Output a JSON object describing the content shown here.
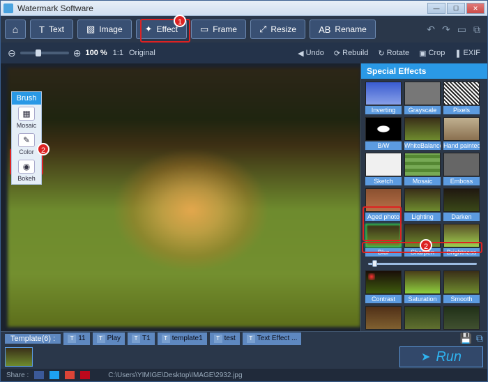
{
  "window": {
    "title": "Watermark Software"
  },
  "toolbar": {
    "tabs": [
      {
        "label": "Text",
        "icon": "T"
      },
      {
        "label": "Image",
        "icon": "▧"
      },
      {
        "label": "Effect",
        "icon": "✦"
      },
      {
        "label": "Frame",
        "icon": "▭"
      },
      {
        "label": "Resize",
        "icon": "⤢"
      },
      {
        "label": "Rename",
        "icon": "AB"
      }
    ]
  },
  "subbar": {
    "zoom_pct": "100 %",
    "ratio": "1:1",
    "size_label": "Original",
    "actions": {
      "undo": "Undo",
      "rebuild": "Rebuild",
      "rotate": "Rotate",
      "crop": "Crop",
      "exif": "EXIF"
    }
  },
  "brush": {
    "header": "Brush",
    "items": [
      {
        "label": "Mosaic",
        "icon": "▦"
      },
      {
        "label": "Color",
        "icon": "✎"
      },
      {
        "label": "Bokeh",
        "icon": "◉"
      }
    ]
  },
  "effects": {
    "header": "Special Effects",
    "items": [
      {
        "label": "Inverting",
        "cls": "t-inv"
      },
      {
        "label": "Grayscale",
        "cls": "t-gray"
      },
      {
        "label": "Pixels",
        "cls": "t-pix"
      },
      {
        "label": "B/W",
        "cls": "t-bw"
      },
      {
        "label": "WhiteBalance",
        "cls": "t-wb"
      },
      {
        "label": "Hand painted",
        "cls": "t-hp"
      },
      {
        "label": "Sketch",
        "cls": "t-sk"
      },
      {
        "label": "Mosaic",
        "cls": "t-mo"
      },
      {
        "label": "Emboss",
        "cls": "t-em"
      },
      {
        "label": "Aged photo",
        "cls": "t-ag"
      },
      {
        "label": "Lighting",
        "cls": "t-lt"
      },
      {
        "label": "Darken",
        "cls": "t-dk"
      },
      {
        "label": "Blur",
        "cls": "t-bl",
        "selected": true
      },
      {
        "label": "Sharpen",
        "cls": "t-sh"
      },
      {
        "label": "Brightness",
        "cls": "t-br"
      },
      {
        "label": "Contrast",
        "cls": "t-co"
      },
      {
        "label": "Saturation",
        "cls": "t-sa"
      },
      {
        "label": "Smooth",
        "cls": "t-sm"
      },
      {
        "label": "",
        "cls": "t-ex1"
      },
      {
        "label": "",
        "cls": "t-ex2"
      },
      {
        "label": "",
        "cls": "t-ex3"
      }
    ]
  },
  "templates": {
    "label": "Template(6) :",
    "items": [
      "11",
      "Play",
      "T1",
      "template1",
      "test",
      "Text Effect ..."
    ]
  },
  "run": {
    "label": "Run"
  },
  "status": {
    "share_label": "Share :",
    "path": "C:\\Users\\YIMIGE\\Desktop\\IMAGE\\2932.jpg"
  },
  "callouts": {
    "c1": "1",
    "c2": "2"
  }
}
